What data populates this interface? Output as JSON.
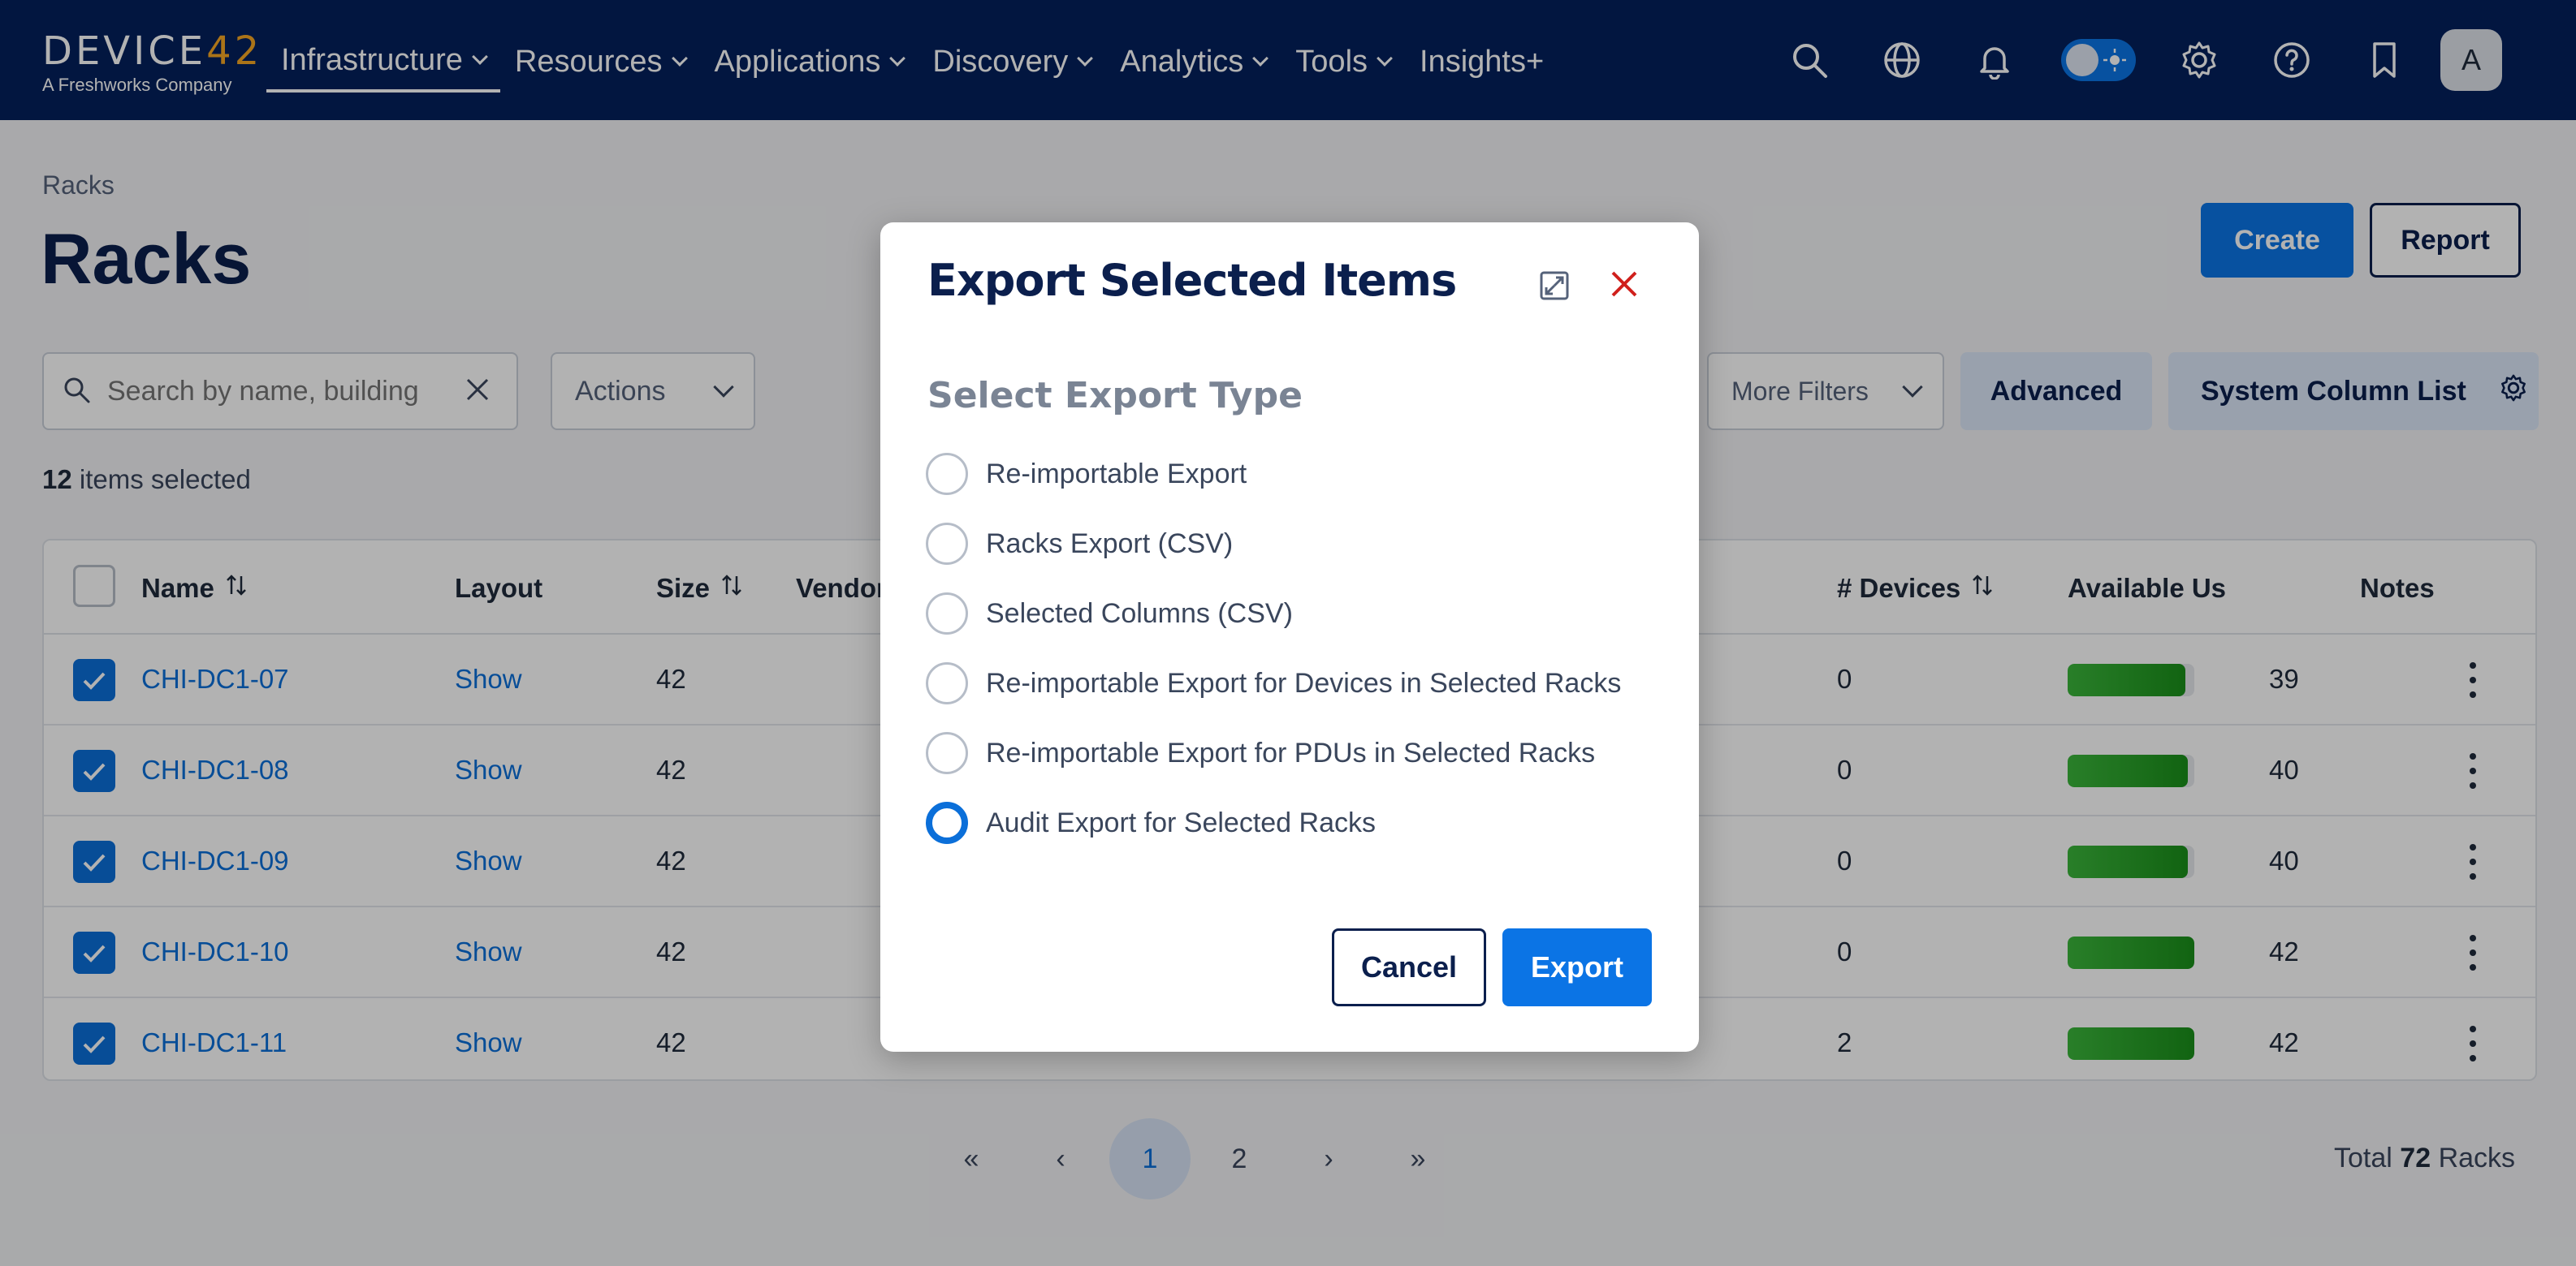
{
  "nav": {
    "logo_main_a": "DEVICE",
    "logo_main_b": "42",
    "logo_sub": "A Freshworks Company",
    "items": [
      {
        "label": "Infrastructure",
        "active": true
      },
      {
        "label": "Resources"
      },
      {
        "label": "Applications"
      },
      {
        "label": "Discovery"
      },
      {
        "label": "Analytics"
      },
      {
        "label": "Tools"
      },
      {
        "label": "Insights+"
      }
    ],
    "icons": [
      "search-icon",
      "globe-icon",
      "bell-icon",
      "theme-toggle",
      "gear-icon",
      "help-icon",
      "bookmark-icon"
    ],
    "avatar": "A"
  },
  "page": {
    "breadcrumb": "Racks",
    "title": "Racks",
    "create_label": "Create",
    "report_label": "Report"
  },
  "toolbar": {
    "search_placeholder": "Search by name, building",
    "actions_label": "Actions",
    "more_filters_label": "More Filters",
    "advanced_label": "Advanced",
    "system_column_list_label": "System Column List"
  },
  "selection": {
    "count": "12",
    "suffix": "items selected"
  },
  "table": {
    "headers": {
      "name": "Name",
      "layout": "Layout",
      "size": "Size",
      "vendor": "Vendor",
      "devices": "# Devices",
      "available_us": "Available Us",
      "notes": "Notes"
    },
    "rows": [
      {
        "name": "CHI-DC1-07",
        "layout": "Show",
        "size": "42",
        "devices": "0",
        "available": "39",
        "available_fraction": 0.93
      },
      {
        "name": "CHI-DC1-08",
        "layout": "Show",
        "size": "42",
        "devices": "0",
        "available": "40",
        "available_fraction": 0.95
      },
      {
        "name": "CHI-DC1-09",
        "layout": "Show",
        "size": "42",
        "devices": "0",
        "available": "40",
        "available_fraction": 0.95
      },
      {
        "name": "CHI-DC1-10",
        "layout": "Show",
        "size": "42",
        "devices": "0",
        "available": "42",
        "available_fraction": 1.0
      },
      {
        "name": "CHI-DC1-11",
        "layout": "Show",
        "size": "42",
        "devices": "2",
        "available": "42",
        "available_fraction": 1.0
      }
    ]
  },
  "pagination": {
    "first": "«",
    "prev": "‹",
    "pages": [
      "1",
      "2"
    ],
    "current": "1",
    "next": "›",
    "last": "»",
    "total_prefix": "Total",
    "total_count": "72",
    "total_suffix": "Racks"
  },
  "modal": {
    "title": "Export Selected Items",
    "section_title": "Select Export Type",
    "options": [
      {
        "label": "Re-importable Export",
        "selected": false
      },
      {
        "label": "Racks Export (CSV)",
        "selected": false
      },
      {
        "label": "Selected Columns (CSV)",
        "selected": false
      },
      {
        "label": "Re-importable Export for Devices in Selected Racks",
        "selected": false
      },
      {
        "label": "Re-importable Export for PDUs in Selected Racks",
        "selected": false
      },
      {
        "label": "Audit Export for Selected Racks",
        "selected": true
      }
    ],
    "cancel_label": "Cancel",
    "export_label": "Export"
  },
  "colors": {
    "nav_bg": "#03205c",
    "accent": "#0b74e5",
    "link": "#0b6fd9",
    "bar_green": "#1a8f1a",
    "close_red": "#d0201c"
  }
}
